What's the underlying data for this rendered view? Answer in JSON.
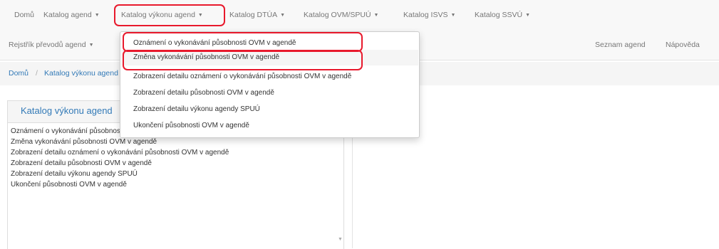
{
  "navbar": {
    "row1": [
      {
        "label": "Domů",
        "caret": false
      },
      {
        "label": "Katalog agend",
        "caret": true
      },
      {
        "label": "Katalog výkonu agend",
        "caret": true
      },
      {
        "label": "Katalog DTÚA",
        "caret": true
      },
      {
        "label": "Katalog OVM/SPUÚ",
        "caret": true
      },
      {
        "label": "Katalog ISVS",
        "caret": true
      },
      {
        "label": "Katalog SSVÚ",
        "caret": true
      }
    ],
    "row2_left": {
      "label": "Rejstřík převodů agend",
      "caret": true
    },
    "right": [
      {
        "label": "Seznam agend"
      },
      {
        "label": "Nápověda"
      }
    ],
    "caret_glyph": "▼"
  },
  "breadcrumb": {
    "items": [
      "Domů",
      "Katalog výkonu agend"
    ],
    "separator": "/"
  },
  "dropdown": {
    "items": [
      "Oznámení o vykonávání působnosti OVM v agendě",
      "Změna vykonávání působnosti OVM v agendě",
      "Zobrazení detailu oznámení o vykonávání působnosti OVM v agendě",
      "Zobrazení detailu působnosti OVM v agendě",
      "Zobrazení detailu výkonu agendy SPUÚ",
      "Ukončení působnosti OVM v agendě"
    ],
    "hovered_index": 1
  },
  "panel": {
    "title": "Katalog výkonu agend",
    "items": [
      "Oznámení o vykonávání působnosti OVM v agendě",
      "Změna vykonávání působnosti OVM v agendě",
      "Zobrazení detailu oznámení o vykonávání působnosti OVM v agendě",
      "Zobrazení detailu působnosti OVM v agendě",
      "Zobrazení detailu výkonu agendy SPUÚ",
      "Ukončení působnosti OVM v agendě"
    ],
    "scroll_arrow": "▼"
  },
  "colors": {
    "link": "#337ab7",
    "nav_text": "#777777",
    "annotation_red": "#e8192c",
    "navbar_bg": "#f8f8f8"
  }
}
